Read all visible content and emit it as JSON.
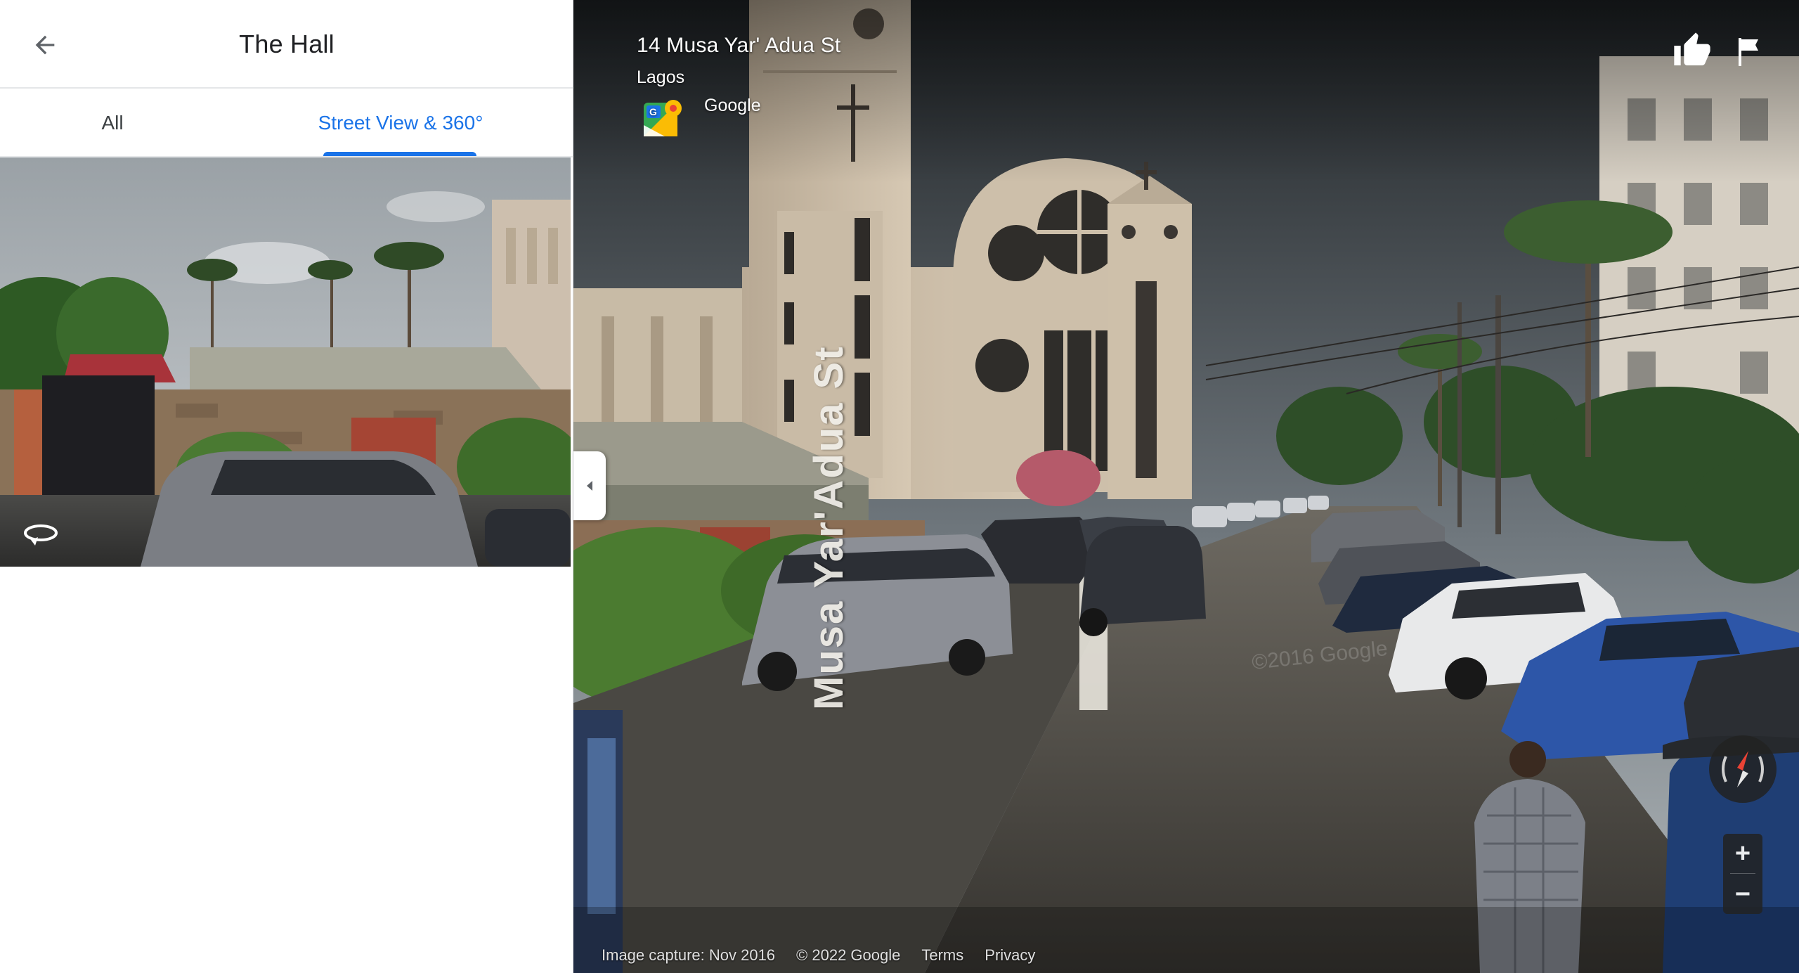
{
  "panel": {
    "title": "The Hall",
    "tabs": [
      {
        "label": "All",
        "active": false
      },
      {
        "label": "Street View & 360°",
        "active": true
      }
    ]
  },
  "street_view": {
    "address": "14 Musa Yar' Adua St",
    "city": "Lagos",
    "provider": "Google",
    "street_sign": "Musa Yar'Adua St",
    "watermark": "©2016 Google",
    "footer": {
      "image_capture": "Image capture: Nov 2016",
      "copyright": "© 2022 Google",
      "terms": "Terms",
      "privacy": "Privacy"
    },
    "zoom": {
      "in": "+",
      "out": "−"
    }
  },
  "icons": {
    "back": "arrow-back-icon",
    "rotate": "360-rotate-icon",
    "collapse": "caret-left-icon",
    "thumbs_up": "thumbs-up-icon",
    "flag": "flag-icon",
    "compass": "compass-icon",
    "maps_logo": "google-maps-logo"
  },
  "colors": {
    "accent": "#1a73e8",
    "title_text": "#202124",
    "tab_text": "#3c4043",
    "control_bg": "#222222"
  }
}
